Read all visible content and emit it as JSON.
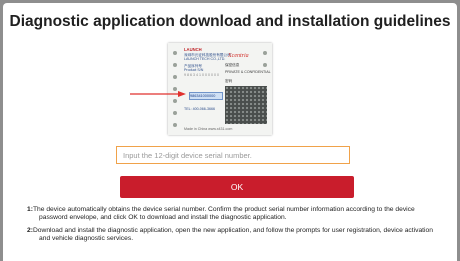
{
  "title": "Diagnostic application download and installation guidelines",
  "envelope": {
    "brand_en": "LAUNCH",
    "brand_script": "Xcentria",
    "company_cn": "深圳市元征科技股份有限公司",
    "company_en": "LAUNCH TECH CO.,LTD.",
    "product_sn_cn": "产品序列号",
    "product_sn_en": "Product S/N",
    "serial_placeholder": "9 8 6 3 4 1 0 0 0 0 0 0",
    "serial_highlight": "986341000000",
    "confidential_cn": "保密信息",
    "confidential_en": "PRIVATE & CONFIDENTIAL",
    "password_cn": "密码",
    "hotline": "TEL: 400-066-3666",
    "footer_line": "Made in China  www.x431.com"
  },
  "input": {
    "placeholder": "Input the 12-digit device serial number.",
    "value": ""
  },
  "ok_button": {
    "label": "OK",
    "color": "#c91d2c"
  },
  "instructions": [
    {
      "num": "1:",
      "text": "The device automatically obtains the device serial number. Confirm the product serial number information according to the device password envelope, and click OK to download and install the diagnostic application."
    },
    {
      "num": "2:",
      "text": "Download and install the diagnostic application, open the new application, and follow the prompts for user registration, device activation and vehicle diagnostic services."
    }
  ],
  "colors": {
    "accent_red": "#c91d2c",
    "input_border": "#f0a24a",
    "frame_gray": "#8e8e8e"
  }
}
